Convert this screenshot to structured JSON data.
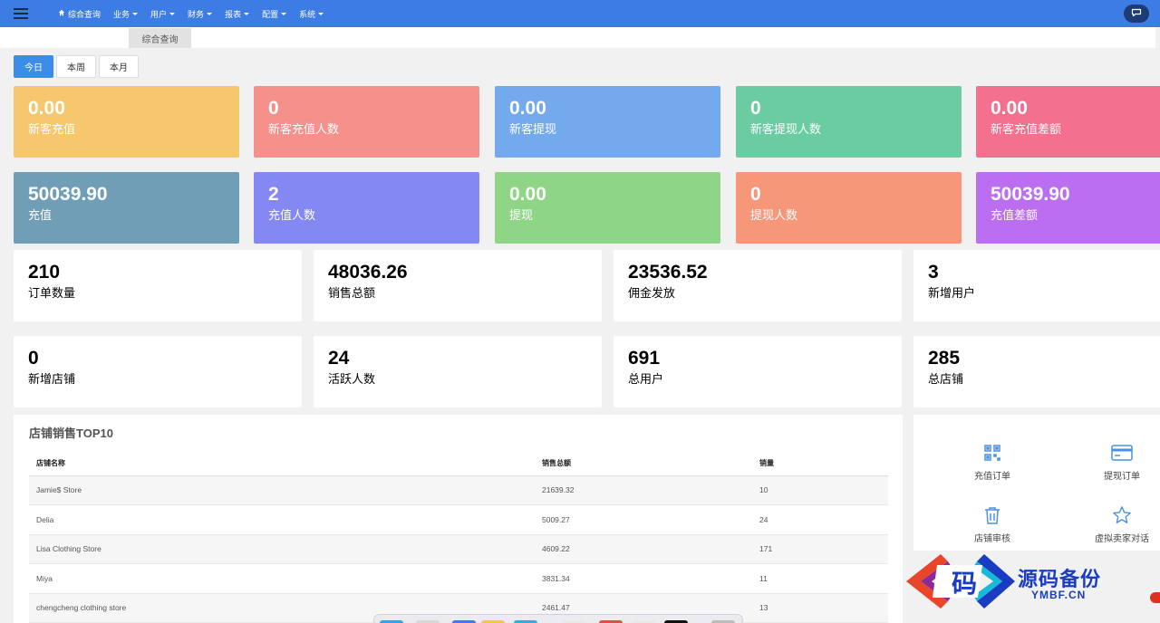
{
  "topbar": {
    "menu": [
      {
        "label": "综合查询",
        "icon": "home-icon",
        "caret": false
      },
      {
        "label": "业务",
        "caret": true
      },
      {
        "label": "用户",
        "caret": true
      },
      {
        "label": "财务",
        "caret": true
      },
      {
        "label": "报表",
        "caret": true
      },
      {
        "label": "配置",
        "caret": true
      },
      {
        "label": "系统",
        "caret": true
      }
    ],
    "color": "#3c7ce4"
  },
  "tabs": {
    "active": "综合查询"
  },
  "period": {
    "today": "今日",
    "week": "本周",
    "month": "本月",
    "selected": "今日"
  },
  "color_cards": [
    {
      "value": "0.00",
      "label": "新客充值",
      "color": "#f6c76c"
    },
    {
      "value": "0",
      "label": "新客充值人数",
      "color": "#f5918a"
    },
    {
      "value": "0.00",
      "label": "新客提现",
      "color": "#73aaee"
    },
    {
      "value": "0",
      "label": "新客提现人数",
      "color": "#6bcca1"
    },
    {
      "value": "0.00",
      "label": "新客充值差额",
      "color": "#f4708f"
    },
    {
      "value": "50039.90",
      "label": "充值",
      "color": "#6f9eb6"
    },
    {
      "value": "2",
      "label": "充值人数",
      "color": "#8388f3"
    },
    {
      "value": "0.00",
      "label": "提现",
      "color": "#8ed685"
    },
    {
      "value": "0",
      "label": "提现人数",
      "color": "#f7977a"
    },
    {
      "value": "50039.90",
      "label": "充值差额",
      "color": "#bb6ff0"
    }
  ],
  "stat_cards": [
    {
      "value": "210",
      "label": "订单数量"
    },
    {
      "value": "48036.26",
      "label": "销售总额"
    },
    {
      "value": "23536.52",
      "label": "佣金发放"
    },
    {
      "value": "3",
      "label": "新增用户"
    },
    {
      "value": "0",
      "label": "新增店铺"
    },
    {
      "value": "24",
      "label": "活跃人数"
    },
    {
      "value": "691",
      "label": "总用户"
    },
    {
      "value": "285",
      "label": "总店铺"
    }
  ],
  "top_stores": {
    "title": "店铺销售TOP10",
    "headers": {
      "name": "店铺名称",
      "amount": "销售总额",
      "qty": "销量"
    },
    "rows": [
      {
        "name": "Jamie$ Store",
        "amount": "21639.32",
        "qty": "10"
      },
      {
        "name": "Delia",
        "amount": "5009.27",
        "qty": "24"
      },
      {
        "name": "Lisa Clothing Store",
        "amount": "4609.22",
        "qty": "171"
      },
      {
        "name": "Miya",
        "amount": "3831.34",
        "qty": "11"
      },
      {
        "name": "chengcheng clothing store",
        "amount": "2461.47",
        "qty": "13"
      }
    ]
  },
  "quick_links": [
    {
      "label": "充值订单",
      "icon": "qr-code-icon"
    },
    {
      "label": "提现订单",
      "icon": "credit-card-icon"
    },
    {
      "label": "店铺审核",
      "icon": "trash-icon"
    },
    {
      "label": "虚拟卖家对话",
      "icon": "star-icon"
    }
  ],
  "watermark": {
    "title": "源码备份",
    "subtitle": "YMBF.CN",
    "glyph": "码"
  }
}
